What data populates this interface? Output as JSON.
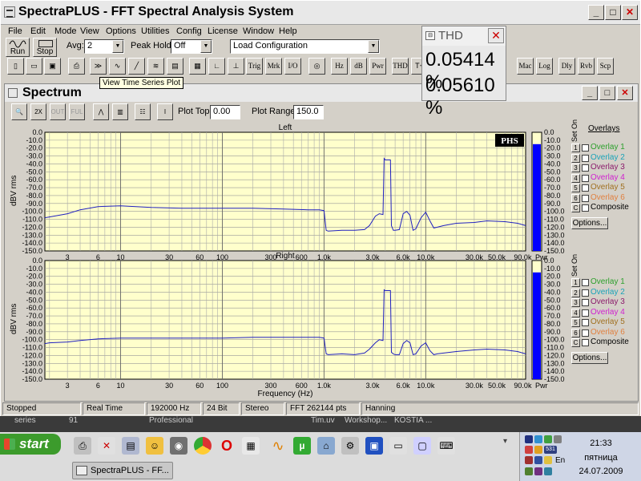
{
  "window": {
    "title": "SpectraPLUS - FFT Spectral Analysis System",
    "minimize": "_",
    "maximize": "□",
    "close": "✕"
  },
  "menu": [
    "File",
    "Edit",
    "Mode",
    "View",
    "Options",
    "Utilities",
    "Config",
    "License",
    "Window",
    "Help"
  ],
  "toolbar": {
    "run_label": "Run",
    "stop_label": "Stop",
    "avg_label": "Avg:",
    "avg_value": "2",
    "peak_hold_label": "Peak Hold:",
    "peak_hold_value": "Off",
    "config_value": "Load Configuration",
    "text_buttons": [
      "Trig",
      "Mrk",
      "I/O",
      "Hz",
      "dB",
      "Pwr",
      "THD",
      "Mac",
      "Log",
      "Dly",
      "Rvb",
      "Scp"
    ],
    "tooltip": "View Time Series Plot"
  },
  "thd": {
    "title": "THD",
    "value1": "0.05414 %",
    "value2": "0.05610 %"
  },
  "spectrum": {
    "title": "Spectrum",
    "plot_top_label": "Plot Top:",
    "plot_top_value": "0.00",
    "plot_range_label": "Plot Range:",
    "plot_range_value": "150.0",
    "phs_label": "PHS",
    "overlays_title": "Overlays",
    "set_on_label": "Set On",
    "overlays": [
      {
        "num": "1",
        "label": "Overlay 1",
        "color": "#2ca02c"
      },
      {
        "num": "2",
        "label": "Overlay 2",
        "color": "#1aa3b8"
      },
      {
        "num": "3",
        "label": "Overlay 3",
        "color": "#8b1a6b"
      },
      {
        "num": "4",
        "label": "Overlay 4",
        "color": "#d020d0"
      },
      {
        "num": "5",
        "label": "Overlay 5",
        "color": "#a07020"
      },
      {
        "num": "6",
        "label": "Overlay 6",
        "color": "#e08040"
      },
      {
        "num": "C",
        "label": "Composite",
        "color": "#000000"
      }
    ],
    "options_label": "Options..."
  },
  "chart_data": [
    {
      "type": "line",
      "title": "Left",
      "ylabel": "dBV rms",
      "xlabel": "Frequency (Hz)",
      "xscale": "log",
      "xlim": [
        1.8,
        96000
      ],
      "ylim": [
        -150,
        0
      ],
      "yticks": [
        "0.0",
        "-10.0",
        "-20.0",
        "-30.0",
        "-40.0",
        "-50.0",
        "-60.0",
        "-70.0",
        "-80.0",
        "-90.0",
        "-100.0",
        "-110.0",
        "-120.0",
        "-130.0",
        "-140.0",
        "-150.0"
      ],
      "xticks": [
        {
          "v": 3,
          "label": "3"
        },
        {
          "v": 6,
          "label": "6"
        },
        {
          "v": 10,
          "label": "10"
        },
        {
          "v": 30,
          "label": "30"
        },
        {
          "v": 60,
          "label": "60"
        },
        {
          "v": 100,
          "label": "100"
        },
        {
          "v": 300,
          "label": "300"
        },
        {
          "v": 600,
          "label": "600"
        },
        {
          "v": 1000,
          "label": "1.0k"
        },
        {
          "v": 3000,
          "label": "3.0k"
        },
        {
          "v": 6000,
          "label": "6.0k"
        },
        {
          "v": 10000,
          "label": "10.0k"
        },
        {
          "v": 30000,
          "label": "30.0k"
        },
        {
          "v": 50000,
          "label": "50.0k"
        },
        {
          "v": 90000,
          "label": "90.0k"
        }
      ],
      "grid": true,
      "line_color": "#2020c0",
      "series": [
        {
          "x": [
            1.8,
            2,
            3,
            4,
            6,
            10,
            20,
            40,
            60,
            100,
            200,
            400,
            700,
            900,
            1000,
            1050,
            1100,
            1500,
            2000,
            2500,
            2800,
            3200,
            3500,
            3800,
            3900,
            4000,
            4500,
            4600,
            4800,
            5000,
            5500,
            6000,
            6500,
            7000,
            7500,
            8000,
            9000,
            10000,
            11000,
            12000,
            13000,
            15000,
            20000,
            30000,
            40000,
            60000,
            80000,
            96000
          ],
          "y": [
            -108,
            -107,
            -103,
            -98,
            -94,
            -93,
            -95,
            -96,
            -96,
            -96,
            -96,
            -97,
            -98,
            -98,
            -99,
            -124,
            -125,
            -124,
            -124,
            -123,
            -118,
            -106,
            -103,
            -104,
            -33,
            -35,
            -35,
            -118,
            -124,
            -124,
            -123,
            -103,
            -100,
            -105,
            -124,
            -122,
            -108,
            -101,
            -112,
            -121,
            -120,
            -118,
            -115,
            -114,
            -112,
            -113,
            -115,
            -118
          ]
        }
      ],
      "bar_meter": {
        "label": "Pwr",
        "ticks": [
          "0.0",
          "-10.0",
          "-20.0",
          "-30.0",
          "-40.0",
          "-50.0",
          "-60.0",
          "-70.0",
          "-80.0",
          "-90.0",
          "-100.0",
          "-110.0",
          "-120.0",
          "-130.0",
          "-140.0",
          "-150.0"
        ],
        "level_db": -15
      }
    },
    {
      "type": "line",
      "title": "Right",
      "ylabel": "dBV rms",
      "xlabel": "Frequency (Hz)",
      "xscale": "log",
      "xlim": [
        1.8,
        96000
      ],
      "ylim": [
        -150,
        0
      ],
      "yticks": [
        "0.0",
        "-10.0",
        "-20.0",
        "-30.0",
        "-40.0",
        "-50.0",
        "-60.0",
        "-70.0",
        "-80.0",
        "-90.0",
        "-100.0",
        "-110.0",
        "-120.0",
        "-130.0",
        "-140.0",
        "-150.0"
      ],
      "xticks": [
        {
          "v": 3,
          "label": "3"
        },
        {
          "v": 6,
          "label": "6"
        },
        {
          "v": 10,
          "label": "10"
        },
        {
          "v": 30,
          "label": "30"
        },
        {
          "v": 60,
          "label": "60"
        },
        {
          "v": 100,
          "label": "100"
        },
        {
          "v": 300,
          "label": "300"
        },
        {
          "v": 600,
          "label": "600"
        },
        {
          "v": 1000,
          "label": "1.0k"
        },
        {
          "v": 3000,
          "label": "3.0k"
        },
        {
          "v": 6000,
          "label": "6.0k"
        },
        {
          "v": 10000,
          "label": "10.0k"
        },
        {
          "v": 30000,
          "label": "30.0k"
        },
        {
          "v": 50000,
          "label": "50.0k"
        },
        {
          "v": 90000,
          "label": "90.0k"
        }
      ],
      "grid": true,
      "line_color": "#2020c0",
      "series": [
        {
          "x": [
            1.8,
            2,
            3,
            4,
            6,
            10,
            20,
            40,
            60,
            100,
            200,
            400,
            700,
            900,
            1000,
            1050,
            1100,
            1500,
            2000,
            2500,
            2800,
            3200,
            3500,
            3800,
            3900,
            4000,
            4500,
            4600,
            4800,
            5000,
            5500,
            6000,
            6500,
            7000,
            7500,
            8000,
            9000,
            10000,
            11000,
            12000,
            13000,
            15000,
            20000,
            30000,
            40000,
            60000,
            80000,
            96000
          ],
          "y": [
            -105,
            -104,
            -103,
            -101,
            -99,
            -98,
            -98,
            -98,
            -98,
            -98,
            -97,
            -97,
            -97,
            -97,
            -98,
            -118,
            -119,
            -118,
            -119,
            -117,
            -112,
            -104,
            -100,
            -101,
            -37,
            -38,
            -38,
            -116,
            -118,
            -119,
            -119,
            -105,
            -101,
            -104,
            -119,
            -118,
            -108,
            -104,
            -114,
            -119,
            -118,
            -117,
            -115,
            -113,
            -112,
            -113,
            -115,
            -118
          ]
        }
      ],
      "bar_meter": {
        "label": "Pwr",
        "ticks": [
          "0.0",
          "-10.0",
          "-20.0",
          "-30.0",
          "-40.0",
          "-50.0",
          "-60.0",
          "-70.0",
          "-80.0",
          "-90.0",
          "-100.0",
          "-110.0",
          "-120.0",
          "-130.0",
          "-140.0",
          "-150.0"
        ],
        "level_db": -15
      }
    }
  ],
  "status": [
    "Stopped",
    "Real Time",
    "192000 Hz",
    "24 Bit",
    "Stereo",
    "FFT 262144 pts",
    "Hanning"
  ],
  "desktop": [
    "series",
    "91",
    "Professional",
    "Tim.uv",
    "Workshop...",
    "KOSTIA ..."
  ],
  "taskbar": {
    "start": "start",
    "task_label": "SpectraPLUS - FF...",
    "time": "21:33",
    "day": "пятница",
    "date": "24.07.2009",
    "lang": "En",
    "tray_num": "531"
  }
}
